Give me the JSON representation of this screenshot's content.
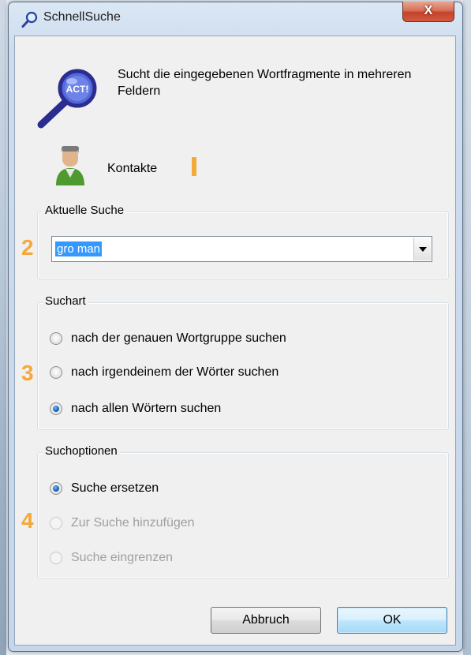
{
  "window": {
    "title": "SchnellSuche",
    "close_label": "X",
    "title_icon": "magnifier-icon"
  },
  "header": {
    "description": "Sucht die eingegebenen Wortfragmente in mehreren Feldern",
    "icon": "act-magnifier-icon",
    "icon_text": "ACT!"
  },
  "record_type": {
    "label": "Kontakte",
    "icon": "contact-person-icon"
  },
  "markers": [
    "1",
    "2",
    "3",
    "4"
  ],
  "current_search": {
    "legend": "Aktuelle Suche",
    "value": "gro man"
  },
  "search_type": {
    "legend": "Suchart",
    "options": [
      {
        "label": "nach der genauen Wortgruppe suchen",
        "checked": false,
        "enabled": true
      },
      {
        "label": "nach irgendeinem der Wörter suchen",
        "checked": false,
        "enabled": true
      },
      {
        "label": "nach allen Wörtern suchen",
        "checked": true,
        "enabled": true
      }
    ]
  },
  "search_options": {
    "legend": "Suchoptionen",
    "options": [
      {
        "label": "Suche ersetzen",
        "checked": true,
        "enabled": true
      },
      {
        "label": "Zur Suche hinzufügen",
        "checked": false,
        "enabled": false
      },
      {
        "label": "Suche eingrenzen",
        "checked": false,
        "enabled": false
      }
    ]
  },
  "buttons": {
    "cancel": "Abbruch",
    "ok": "OK"
  },
  "colors": {
    "marker": "#f5a93a",
    "selection": "#3399ff",
    "close_button": "#c4432c"
  }
}
